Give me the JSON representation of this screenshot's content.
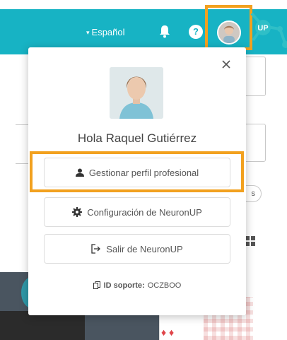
{
  "topbar": {
    "language_label": "Español",
    "help_label": "?",
    "logo_text": "UP"
  },
  "background": {
    "pill_text": "s"
  },
  "dropdown": {
    "greeting": "Hola Raquel Gutiérrez",
    "manage_profile_label": "Gestionar perfil profesional",
    "settings_label": "Configuración de NeuronUP",
    "logout_label": "Salir de NeuronUP",
    "support_id_label": "ID soporte:",
    "support_id_value": "OCZBOO"
  },
  "colors": {
    "topbar": "#17b3c4",
    "highlight": "#f2a11f",
    "logo": "#2fbfc7"
  }
}
